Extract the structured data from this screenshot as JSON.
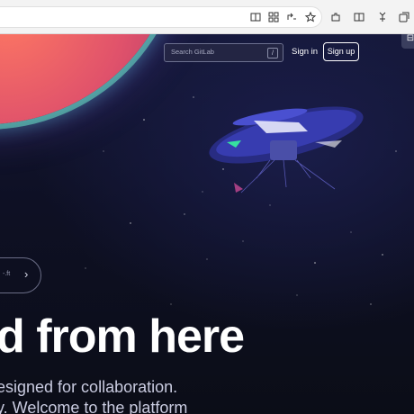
{
  "page": {
    "search": {
      "placeholder": "Search GitLab",
      "shortcut": "/"
    },
    "sign_in": "Sign in",
    "sign_up": "Sign up",
    "pill_fragment": "-.ft",
    "pill_chevron": "›",
    "headline": "d from here",
    "subtitle_line1": "esigned for collaboration.",
    "subtitle_line2": "y. Welcome to the platform"
  },
  "browser": {
    "icons": [
      "reader-icon",
      "apps-icon",
      "read-aloud-icon",
      "favorites-icon",
      "extensions-icon",
      "split-screen-icon",
      "favorites-bar-icon",
      "collections-icon"
    ]
  }
}
